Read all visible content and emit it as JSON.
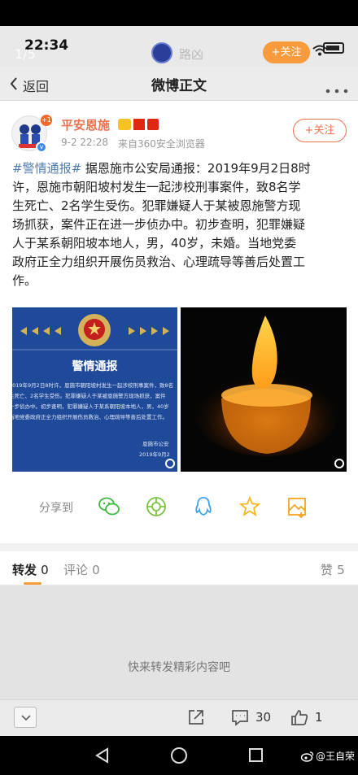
{
  "status_bar": {
    "time": "22:34",
    "page_counter": "1/5",
    "username": "路凶",
    "follow_label": "+关注"
  },
  "nav": {
    "back_label": "返回",
    "title": "微博正文"
  },
  "post": {
    "author": "平安恩施",
    "time": "9-2 22:28",
    "source": "来自360安全浏览器",
    "follow_label": "+关注",
    "hashtag": "#警情通报#",
    "lines": [
      "据恩施市公安局通报：2019年9月2日8时",
      "许，恩施市朝阳坡村发生一起涉校刑事案件，致8名学",
      "生死亡、2名学生受伤。犯罪嫌疑人于某被恩施警方现",
      "场抓获，案件正在进一步侦办中。初步查明，犯罪嫌疑",
      "人于某系朝阳坡本地人，男，40岁，未婚。当地党委",
      "政府正全力组织开展伤员救治、心理疏导等善后处置工",
      "作。"
    ],
    "image1": {
      "heading": "警情通报",
      "body": [
        "2019年9月2日8时许，恩施市朝阳坡村发生一起涉校刑事案件，致8名",
        "生死亡、2名学生受伤。犯罪嫌疑人于某被恩施警方现场抓获，案件",
        "一步侦办中。初步查明，犯罪嫌疑人于某系朝阳坡本地人，男，40岁",
        "当地党委政府正全力组织开展伤员救治、心理疏导等善后处置工作。"
      ],
      "signature": "恩施市公安",
      "date": "2019年9月2"
    },
    "share_label": "分享到"
  },
  "tabs": {
    "repost": "转发",
    "repost_count": "0",
    "comment": "评论",
    "comment_count": "0",
    "like": "赞",
    "like_count": "5"
  },
  "empty_text": "快来转发精彩内容吧",
  "bottom": {
    "comment_count": "30",
    "like_count": "1"
  },
  "watermark": "@王自荣",
  "colors": {
    "accent": "#eb7350",
    "link": "#507daf",
    "poster_blue": "#1f4a9a"
  }
}
